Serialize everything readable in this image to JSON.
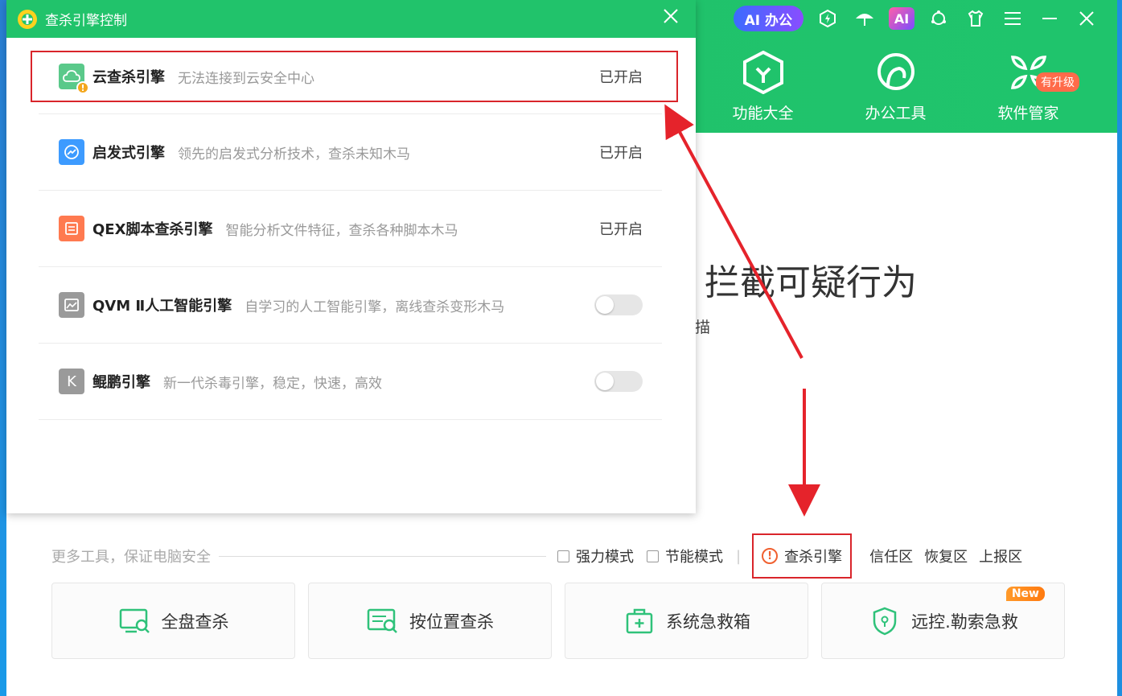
{
  "dialog": {
    "title": "查杀引擎控制",
    "engines": [
      {
        "name": "云查杀引擎",
        "desc": "无法连接到云安全中心",
        "status": "已开启",
        "icon": "cloud-warning-icon",
        "color": "#5ac98a"
      },
      {
        "name": "启发式引擎",
        "desc": "领先的启发式分析技术，查杀未知木马",
        "status": "已开启",
        "icon": "heuristic-icon",
        "color": "#3d9bff"
      },
      {
        "name": "QEX脚本查杀引擎",
        "desc": "智能分析文件特征，查杀各种脚本木马",
        "status": "已开启",
        "icon": "script-icon",
        "color": "#ff7a50"
      },
      {
        "name": "QVM Ⅱ人工智能引擎",
        "desc": "自学习的人工智能引擎，离线查杀变形木马",
        "status": "",
        "icon": "ai-engine-icon",
        "color": "#9a9a9a"
      },
      {
        "name": "鲲鹏引擎",
        "desc": "新一代杀毒引擎，稳定，快速，高效",
        "status": "",
        "icon": "kunpeng-icon",
        "color": "#9a9a9a",
        "letter": "K"
      }
    ]
  },
  "topbar": {
    "ai_office": "AI 办公",
    "ai_badge": "AI"
  },
  "nav": [
    {
      "label": "功能大全",
      "icon": "feature-cube-icon"
    },
    {
      "label": "办公工具",
      "icon": "office-tools-icon"
    },
    {
      "label": "软件管家",
      "icon": "software-manager-icon",
      "badge": "有升级"
    }
  ],
  "hero": {
    "title": "拦截可疑行为",
    "subtitle": "描"
  },
  "tools": {
    "caption": "更多工具，保证电脑安全",
    "force_mode": "强力模式",
    "power_save": "节能模式",
    "separator": "|",
    "engine_link": "查杀引擎",
    "trust_zone": "信任区",
    "restore_zone": "恢复区",
    "report_zone": "上报区",
    "cards": [
      {
        "label": "全盘查杀",
        "icon": "full-scan-icon"
      },
      {
        "label": "按位置查杀",
        "icon": "location-scan-icon"
      },
      {
        "label": "系统急救箱",
        "icon": "first-aid-icon"
      },
      {
        "label": "远控.勒索急救",
        "icon": "shield-icon",
        "badge": "New"
      }
    ]
  },
  "colors": {
    "brand_green": "#21c36b",
    "annotation_red": "#d9252b"
  }
}
